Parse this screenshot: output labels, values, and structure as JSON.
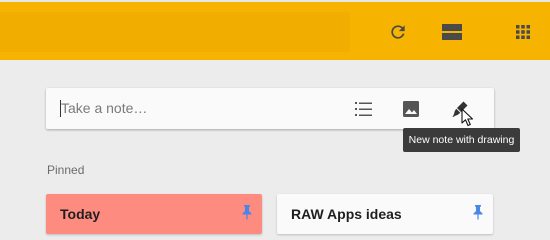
{
  "header": {
    "background_color": "#f6b400",
    "icons": [
      "refresh-icon",
      "list-view-icon",
      "apps-grid-icon"
    ]
  },
  "note_input": {
    "placeholder": "Take a note…",
    "value": "",
    "tools": [
      "new-list-icon",
      "new-image-icon",
      "new-drawing-icon"
    ]
  },
  "tooltip": {
    "text": "New note with drawing"
  },
  "sections": {
    "pinned_label": "Pinned"
  },
  "notes": [
    {
      "title": "Today",
      "color": "#fd8b80",
      "pinned": true
    },
    {
      "title": "RAW Apps ideas",
      "color": "#fafafa",
      "pinned": true
    }
  ],
  "colors": {
    "pin": "#4a86e8",
    "page_background": "#ececec",
    "tooltip_background": "#3b3b3b"
  }
}
